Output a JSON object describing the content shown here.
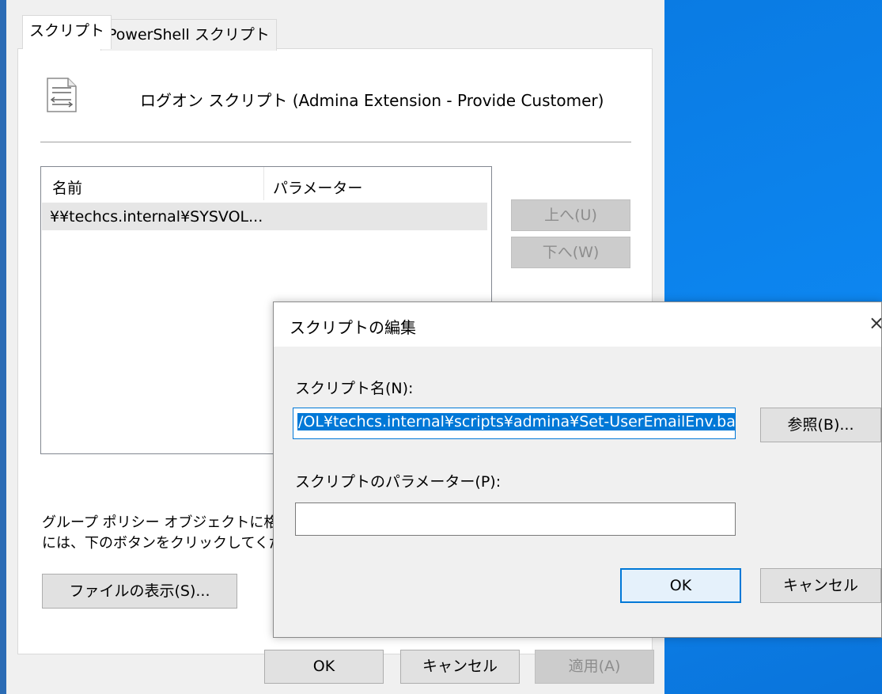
{
  "tabs": [
    {
      "label": "スクリプト",
      "active": true
    },
    {
      "label": "PowerShell スクリプト",
      "active": false
    }
  ],
  "header": {
    "title": "ログオン スクリプト (Admina Extension - Provide Customer)",
    "icon": "script-file-icon"
  },
  "list": {
    "columns": [
      "名前",
      "パラメーター"
    ],
    "rows": [
      {
        "name": "¥¥techcs.internal¥SYSVOL...",
        "params": ""
      }
    ]
  },
  "side_buttons": {
    "up": "上へ(U)",
    "down": "下へ(W)"
  },
  "info_text": {
    "line1": "グループ ポリシー オブジェクトに格納さ",
    "line2": "には、下のボタンをクリックしてくださ"
  },
  "show_files_button": "ファイルの表示(S)...",
  "footer": {
    "ok": "OK",
    "cancel": "キャンセル",
    "apply": "適用(A)"
  },
  "dialog": {
    "title": "スクリプトの編集",
    "close": "×",
    "script_name_label": "スクリプト名(N):",
    "script_name_value": "/OL¥techcs.internal¥scripts¥admina¥Set-UserEmailEnv.bat",
    "browse_button": "参照(B)...",
    "params_label": "スクリプトのパラメーター(P):",
    "params_value": "",
    "ok": "OK",
    "cancel": "キャンセル"
  },
  "colors": {
    "accent": "#0078d7",
    "desktop": "#0a7be3"
  }
}
